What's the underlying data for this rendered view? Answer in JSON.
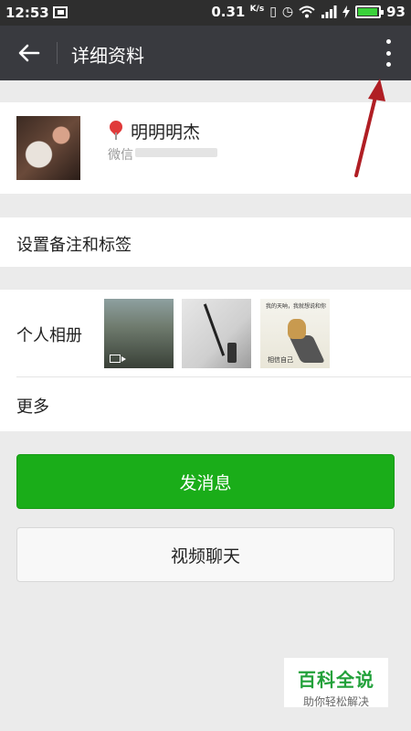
{
  "status_bar": {
    "time": "12:53",
    "net_speed": "0.31",
    "net_unit": "K/s",
    "battery_level": "93",
    "battery_fraction": 0.93,
    "icons": [
      "image-notification-icon",
      "vibrate-icon",
      "alarm-icon",
      "wifi-icon",
      "signal-icon",
      "charging-icon",
      "battery-icon"
    ]
  },
  "header": {
    "title": "详细资料"
  },
  "profile": {
    "name": "明明明杰",
    "wechat_label": "微信"
  },
  "rows": {
    "remark": "设置备注和标签",
    "album": "个人相册",
    "more": "更多"
  },
  "album_thumb3": {
    "caption_top": "我的天呐，我就想说和你",
    "caption_bottom": "相信自己"
  },
  "buttons": {
    "send_message": "发消息",
    "video_chat": "视频聊天"
  },
  "watermark": {
    "title": "百科全说",
    "subtitle": "助你轻松解决"
  },
  "colors": {
    "primary": "#1aad19",
    "appbar": "#393a3f",
    "annotation_arrow": "#b01e24"
  }
}
